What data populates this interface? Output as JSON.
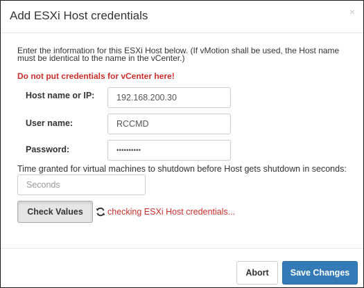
{
  "dialog": {
    "title": "Add ESXi Host credentials",
    "close_label": "×"
  },
  "form": {
    "intro": "Enter the information for this ESXi Host below. (If vMotion shall be used, the Host name must be identical to the name in the vCenter.)",
    "warning": "Do not put credentials for vCenter here!",
    "host": {
      "label": "Host name or IP:",
      "value": "192.168.200.30"
    },
    "user": {
      "label": "User name:",
      "value": "RCCMD"
    },
    "password": {
      "label": "Password:",
      "value": "••••••••••"
    },
    "shutdown_time": {
      "label": "Time granted for virtual machines to shutdown before Host gets shutdown in seconds:",
      "value": "",
      "placeholder": "Seconds"
    },
    "check_button_label": "Check Values",
    "status_icon": "refresh-icon",
    "status_text": "checking ESXi Host credentials..."
  },
  "footer": {
    "abort_label": "Abort",
    "save_label": "Save Changes"
  },
  "colors": {
    "warning": "#c9302c",
    "primary": "#337ab7",
    "border": "#cccccc",
    "text": "#333333"
  }
}
